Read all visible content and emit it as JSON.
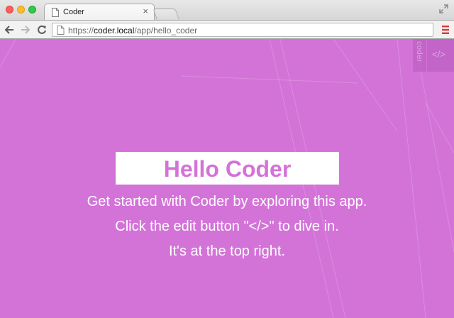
{
  "browser": {
    "tab_title": "Coder",
    "tab_close": "×",
    "url_scheme": "https://",
    "url_host": "coder.local",
    "url_path": "/app/hello_coder"
  },
  "app": {
    "coder_tab_label": "coder",
    "edit_tab_label": "</>",
    "heading": "Hello Coder",
    "intro_lines": [
      "Get started with Coder by exploring this app.",
      "Click the edit button \"</>\" to dive in.",
      "It's at the top right."
    ]
  },
  "colors": {
    "background": "#d373d8",
    "heading_text": "#d373d8",
    "heading_box": "#ffffff",
    "body_text": "#ffffff",
    "menu_icon": "#d9392f"
  },
  "icons": {
    "tab": "page-icon",
    "fullscreen": "expand-icon",
    "back": "arrow-left-icon",
    "forward": "arrow-right-icon",
    "reload": "reload-icon",
    "omnibox": "page-icon",
    "menu": "hamburger-menu-icon"
  }
}
